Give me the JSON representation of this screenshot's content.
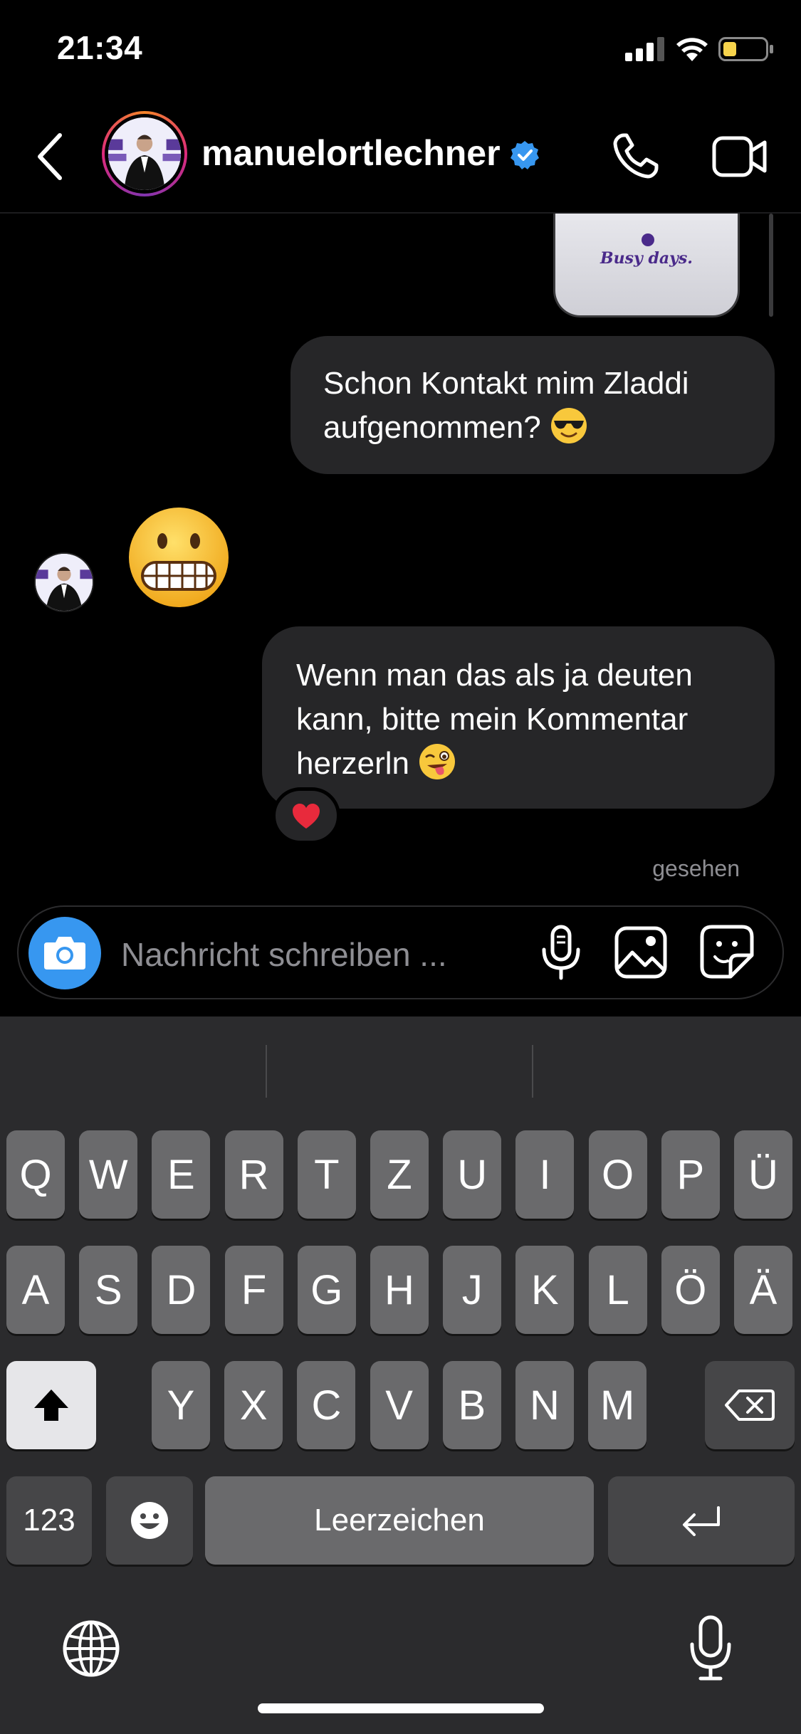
{
  "status_bar": {
    "time": "21:34"
  },
  "header": {
    "username": "manuelortlechner"
  },
  "messages": {
    "sticker_text": "Busy days.",
    "msg1": "Schon Kontakt mim Zladdi aufgenommen?",
    "msg2": "Wenn man das als ja deuten kann, bitte mein Kommentar herzerln",
    "seen": "gesehen"
  },
  "composer": {
    "placeholder": "Nachricht schreiben ..."
  },
  "keyboard": {
    "row1": [
      "Q",
      "W",
      "E",
      "R",
      "T",
      "Z",
      "U",
      "I",
      "O",
      "P",
      "Ü"
    ],
    "row2": [
      "A",
      "S",
      "D",
      "F",
      "G",
      "H",
      "J",
      "K",
      "L",
      "Ö",
      "Ä"
    ],
    "row3": [
      "Y",
      "X",
      "C",
      "V",
      "B",
      "N",
      "M"
    ],
    "numbers_label": "123",
    "space_label": "Leerzeichen"
  },
  "colors": {
    "accent": "#3797f0",
    "bubble": "#262628",
    "keyboard_bg": "#2b2b2d"
  },
  "icons": [
    "back-icon",
    "verified-icon",
    "phone-icon",
    "video-icon",
    "camera-icon",
    "microphone-icon",
    "gallery-icon",
    "sticker-icon",
    "shift-icon",
    "delete-icon",
    "emoji-icon",
    "return-icon",
    "globe-icon"
  ]
}
